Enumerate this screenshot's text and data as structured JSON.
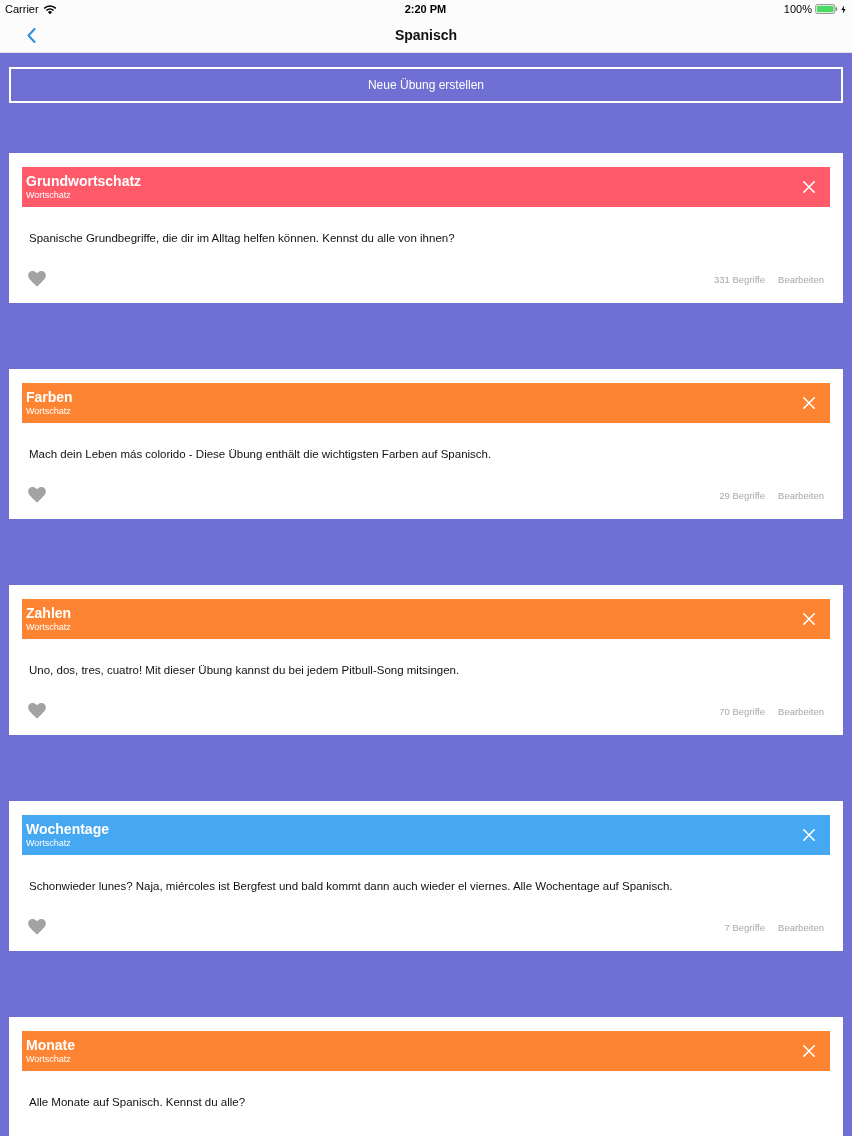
{
  "status_bar": {
    "carrier": "Carrier",
    "time": "2:20 PM",
    "battery": "100%"
  },
  "nav": {
    "title": "Spanisch"
  },
  "new_exercise_button": {
    "label": "Neue Übung erstellen"
  },
  "exercises": [
    {
      "title": "Grundwortschatz",
      "category": "Wortschatz",
      "color": "#ff5a6a",
      "description": "Spanische Grundbegriffe, die dir im Alltag helfen können. Kennst du alle von ihnen?",
      "count": "331 Begriffe",
      "edit": "Bearbeiten"
    },
    {
      "title": "Farben",
      "category": "Wortschatz",
      "color": "#fd8433",
      "description": "Mach dein Leben más colorido - Diese Übung enthält die wichtigsten Farben auf Spanisch.",
      "count": "29 Begriffe",
      "edit": "Bearbeiten"
    },
    {
      "title": "Zahlen",
      "category": "Wortschatz",
      "color": "#fd8433",
      "description": "Uno, dos, tres, cuatro! Mit dieser Übung kannst du bei jedem Pitbull-Song mitsingen.",
      "count": "70 Begriffe",
      "edit": "Bearbeiten"
    },
    {
      "title": "Wochentage",
      "category": "Wortschatz",
      "color": "#45a8f0",
      "description": "Schonwieder lunes? Naja, miércoles ist Bergfest und bald kommt dann auch wieder el viernes. Alle Wochentage auf Spanisch.",
      "count": "7 Begriffe",
      "edit": "Bearbeiten"
    },
    {
      "title": "Monate",
      "category": "Wortschatz",
      "color": "#fd8433",
      "description": "Alle Monate auf Spanisch. Kennst du alle?"
    }
  ]
}
